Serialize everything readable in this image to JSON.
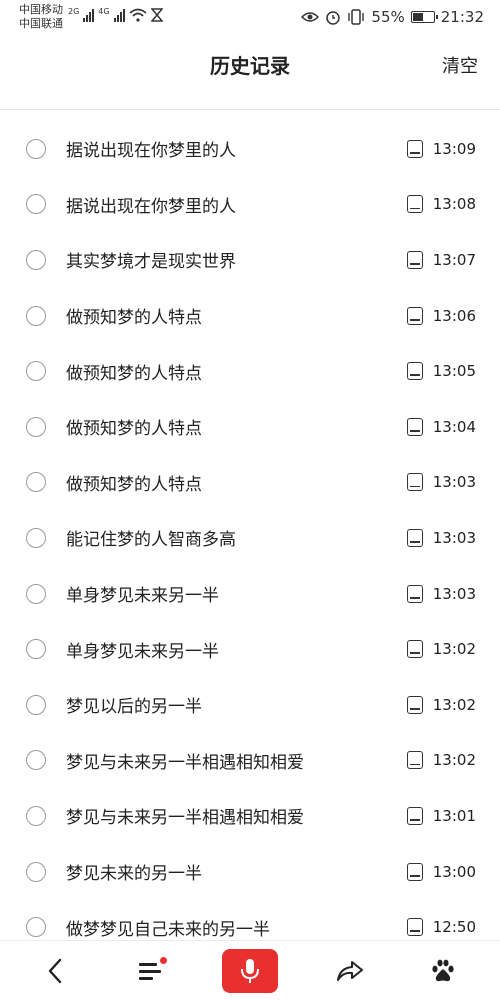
{
  "status_bar": {
    "carrier_1": "中国移动",
    "carrier_2": "中国联通",
    "net_1": "2G",
    "net_2": "4G",
    "battery": "55%",
    "battery_level": 0.55,
    "time": "21:32",
    "icons": [
      "eye-icon",
      "alarm-icon",
      "vibrate-icon",
      "battery-icon",
      "wifi-icon",
      "hourglass-icon"
    ]
  },
  "header": {
    "title": "历史记录",
    "clear_label": "清空"
  },
  "history": [
    {
      "query": "据说出现在你梦里的人",
      "time": "13:09"
    },
    {
      "query": "据说出现在你梦里的人",
      "time": "13:08"
    },
    {
      "query": "其实梦境才是现实世界",
      "time": "13:07"
    },
    {
      "query": "做预知梦的人特点",
      "time": "13:06"
    },
    {
      "query": "做预知梦的人特点",
      "time": "13:05"
    },
    {
      "query": "做预知梦的人特点",
      "time": "13:04"
    },
    {
      "query": "做预知梦的人特点",
      "time": "13:03"
    },
    {
      "query": "能记住梦的人智商多高",
      "time": "13:03"
    },
    {
      "query": "单身梦见未来另一半",
      "time": "13:03"
    },
    {
      "query": "单身梦见未来另一半",
      "time": "13:02"
    },
    {
      "query": "梦见以后的另一半",
      "time": "13:02"
    },
    {
      "query": "梦见与未来另一半相遇相知相爱",
      "time": "13:02"
    },
    {
      "query": "梦见与未来另一半相遇相知相爱",
      "time": "13:01"
    },
    {
      "query": "梦见未来的另一半",
      "time": "13:00"
    },
    {
      "query": "做梦梦见自己未来的另一半",
      "time": "12:50"
    }
  ],
  "bottom_nav": {
    "items": [
      "back-icon",
      "menu-icon",
      "mic-icon",
      "share-icon",
      "baidu-paw-icon"
    ],
    "accent": "#e8312f"
  }
}
